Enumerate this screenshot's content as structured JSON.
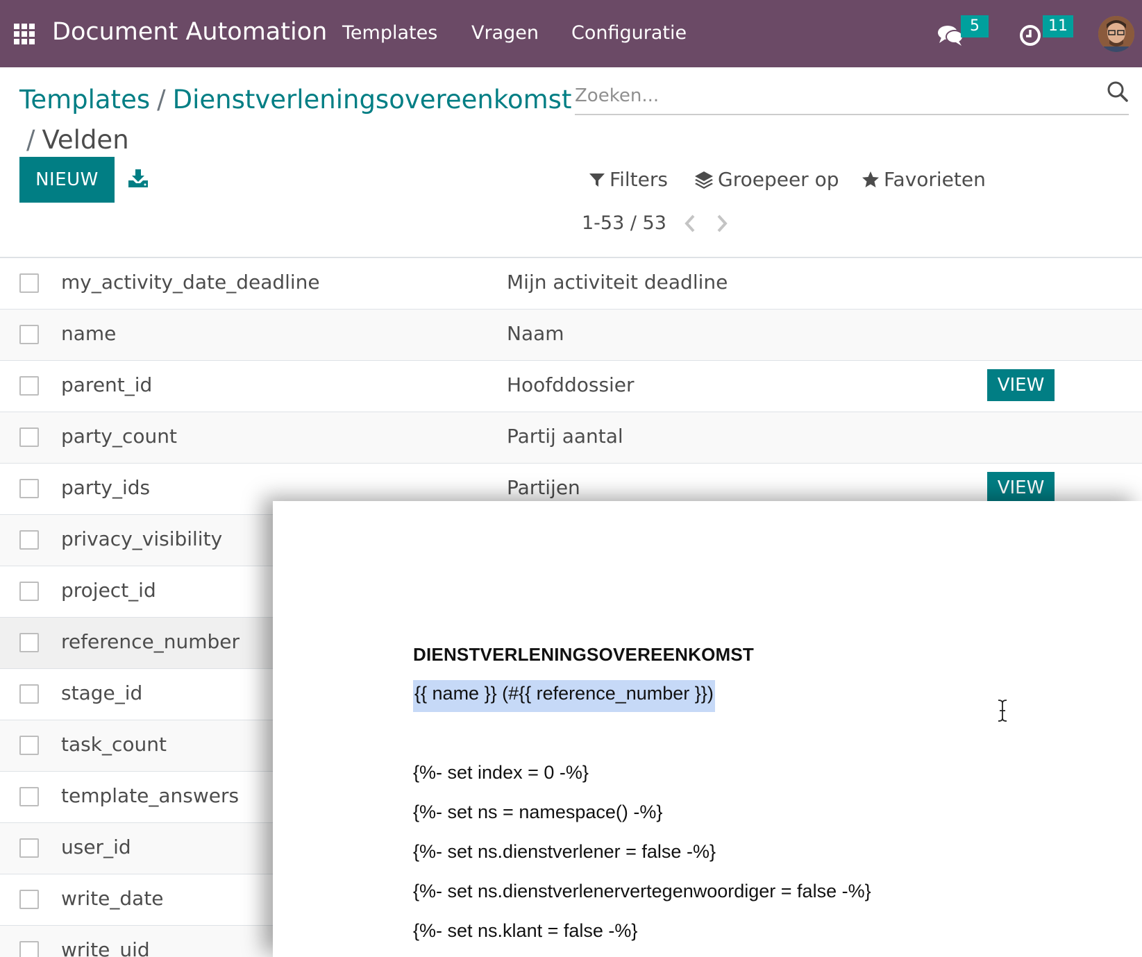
{
  "navbar": {
    "app_title": "Document Automation",
    "menu": [
      "Templates",
      "Vragen",
      "Configuratie"
    ],
    "chat_count": "5",
    "activity_count": "11",
    "color": "#6b4a66"
  },
  "breadcrumb": {
    "items": [
      "Templates",
      "Dienstverleningsovereenkomst"
    ],
    "separator": "/",
    "current": "Velden"
  },
  "search": {
    "placeholder": "Zoeken..."
  },
  "actions": {
    "new_label": "NIEUW"
  },
  "filters": {
    "filters_label": "Filters",
    "group_label": "Groepeer op",
    "favorites_label": "Favorieten"
  },
  "pager": {
    "value": "1-53 / 53"
  },
  "rows": [
    {
      "name": "my_activity_date_deadline",
      "desc": "Mijn activiteit deadline",
      "view": ""
    },
    {
      "name": "name",
      "desc": "Naam",
      "view": ""
    },
    {
      "name": "parent_id",
      "desc": "Hoofddossier",
      "view": "VIEW"
    },
    {
      "name": "party_count",
      "desc": "Partij aantal",
      "view": ""
    },
    {
      "name": "party_ids",
      "desc": "Partijen",
      "view": "VIEW"
    },
    {
      "name": "privacy_visibility",
      "desc": "",
      "view": ""
    },
    {
      "name": "project_id",
      "desc": "",
      "view": ""
    },
    {
      "name": "reference_number",
      "desc": "",
      "view": ""
    },
    {
      "name": "stage_id",
      "desc": "",
      "view": ""
    },
    {
      "name": "task_count",
      "desc": "",
      "view": ""
    },
    {
      "name": "template_answers",
      "desc": "",
      "view": ""
    },
    {
      "name": "user_id",
      "desc": "",
      "view": ""
    },
    {
      "name": "write_date",
      "desc": "",
      "view": ""
    },
    {
      "name": "write_uid",
      "desc": "",
      "view": ""
    }
  ],
  "document": {
    "title": "DIENSTVERLENINGSOVEREENKOMST",
    "lines": [
      "{{ name }} (#{{ reference_number }})",
      "{%- set index = 0 -%}",
      "{%- set ns = namespace() -%}",
      "{%- set ns.dienstverlener = false -%}",
      "{%- set ns.dienstverlenervertegenwoordiger = false -%}",
      "{%- set ns.klant = false -%}"
    ]
  },
  "colors": {
    "accent": "#017e84",
    "badge": "#00a09d",
    "highlight": "#c6d9f7"
  }
}
